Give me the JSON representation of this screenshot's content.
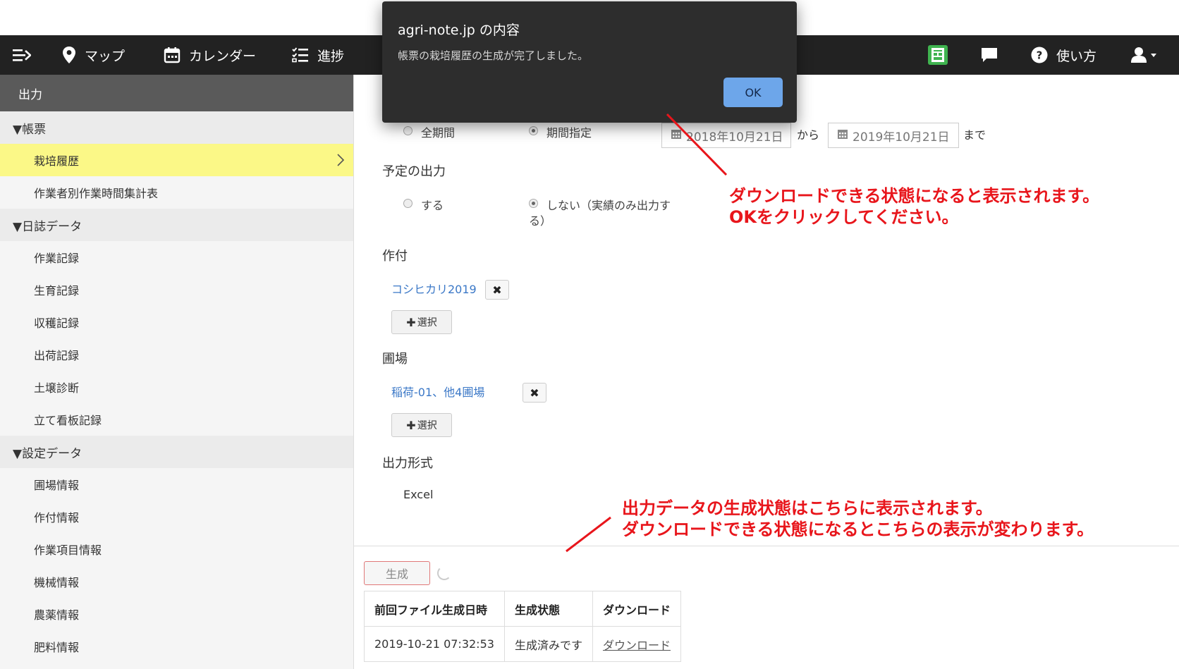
{
  "topbar": {
    "menu_icon": "menu-arrow-icon",
    "items": [
      {
        "label": "マップ",
        "icon": "map-pin-icon"
      },
      {
        "label": "カレンダー",
        "icon": "calendar-icon"
      },
      {
        "label": "進捗",
        "icon": "checklist-icon"
      }
    ],
    "right": {
      "report_icon": "report-book-icon",
      "chat_icon": "chat-icon",
      "help_label": "使い方",
      "help_icon": "question-circle-icon",
      "user_icon": "user-icon"
    },
    "accent": "#3fb34f"
  },
  "sidebar": {
    "header": "出力",
    "sections": [
      {
        "title": "▼帳票",
        "items": [
          "栽培履歴",
          "作業者別作業時間集計表"
        ]
      },
      {
        "title": "▼日誌データ",
        "items": [
          "作業記録",
          "生育記録",
          "収穫記録",
          "出荷記録",
          "土壌診断",
          "立て看板記録"
        ]
      },
      {
        "title": "▼設定データ",
        "items": [
          "圃場情報",
          "作付情報",
          "作業項目情報",
          "機械情報",
          "農薬情報",
          "肥料情報"
        ]
      }
    ],
    "active_item": "栽培履歴",
    "active_color": "#fbf887"
  },
  "form": {
    "period": {
      "all_label": "全期間",
      "range_label": "期間指定",
      "selected": "期間指定",
      "from_date": "2018年10月21日",
      "from_suffix": "から",
      "to_date": "2019年10月21日",
      "to_suffix": "まで"
    },
    "planned": {
      "label": "予定の出力",
      "yes_label": "する",
      "no_label_line1": "しない（実績のみ出力す",
      "no_label_line2": "る）",
      "selected": "しない（実績のみ出力する）"
    },
    "crop": {
      "label": "作付",
      "value": "コシヒカリ2019",
      "select_label": "選択"
    },
    "field": {
      "label": "圃場",
      "value": "稲荷-01、他4圃場",
      "select_label": "選択"
    },
    "format": {
      "label": "出力形式",
      "value": "Excel"
    },
    "generate_label": "生成"
  },
  "output_table": {
    "headers": [
      "前回ファイル生成日時",
      "生成状態",
      "ダウンロード"
    ],
    "rows": [
      [
        "2019-10-21 07:32:53",
        "生成済みです",
        "ダウンロード"
      ]
    ]
  },
  "dialog": {
    "title": "agri-note.jp の内容",
    "message": "帳票の栽培履歴の生成が完了しました。",
    "ok_label": "OK"
  },
  "annotations": {
    "note1_line1": "ダウンロードできる状態になると表示されます。",
    "note1_line2": "OKをクリックしてください。",
    "note2_line1": "出力データの生成状態はこちらに表示されます。",
    "note2_line2": "ダウンロードできる状態になるとこちらの表示が変わります。",
    "color": "#e8151b"
  }
}
